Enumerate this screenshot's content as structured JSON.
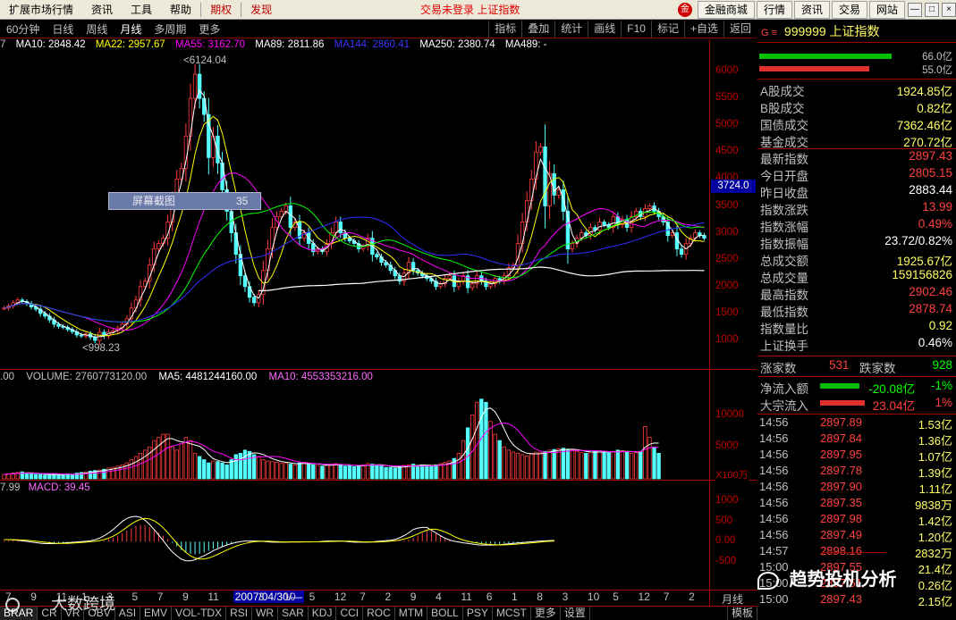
{
  "menu": {
    "items": [
      "扩展市场行情",
      "资讯",
      "工具",
      "帮助"
    ],
    "hl_items": [
      "期权",
      "发现"
    ],
    "center": "交易未登录  上证指数",
    "right_logo": "金",
    "right_buttons": [
      "金融商城",
      "行情",
      "资讯",
      "交易",
      "网站"
    ],
    "win": [
      "—",
      "□",
      "×"
    ]
  },
  "toolbar": {
    "items": [
      "60分钟",
      "日线",
      "周线",
      "月线",
      "多周期",
      "更多"
    ],
    "active_index": 3,
    "right": [
      "指标",
      "叠加",
      "统计",
      "画线",
      "F10",
      "标记",
      "+自选",
      "返回"
    ]
  },
  "ma_text": {
    "prefix": "7",
    "ma10": "MA10: 2848.42",
    "ma22": "MA22: 2957.67",
    "ma55": "MA55: 3162.70",
    "ma89": "MA89: 2811.86",
    "ma144": "MA144: 2860.41",
    "ma250": "MA250: 2380.74",
    "ma489": "MA489: -"
  },
  "colors": {
    "up": "#ff3c3c",
    "up_fill": "#000000",
    "down": "#54ffff",
    "ma10": "#ffffff",
    "ma22": "#ffff00",
    "ma55": "#ff00ff",
    "ma89": "#00ff00",
    "ma144": "#3030ff",
    "ma250": "#ffffff",
    "axis": "#c00000"
  },
  "main_axis": {
    "ticks": [
      "6000",
      "5500",
      "5000",
      "4500",
      "4000",
      "3500",
      "3000",
      "2500",
      "2000",
      "1500",
      "1000"
    ],
    "ylim": [
      700,
      6300
    ],
    "cursor_value": "3724.0"
  },
  "annotations": {
    "high": "6124.04",
    "low": "998.23"
  },
  "volume": {
    "label_prefix": ".00",
    "volume": "VOLUME: 2760773120.00",
    "ma5": "MA5: 4481244160.00",
    "ma10": "MA10: 4553353216.00",
    "ticks": [
      "10000",
      "5000"
    ],
    "unit": "X100万",
    "ylim": [
      0,
      14000
    ]
  },
  "macd": {
    "label_prefix": "7.99",
    "macd": "MACD: 39.45",
    "ticks": [
      "1000",
      "500",
      "0.00",
      "-500"
    ],
    "ylim": [
      -1100,
      1200
    ]
  },
  "xaxis": {
    "labels": [
      "7",
      "9",
      "11",
      "1",
      "3",
      "5",
      "7",
      "9",
      "11",
      "2007/04/30/—",
      "3",
      "10",
      "5",
      "12",
      "7",
      "2",
      "9",
      "4",
      "11",
      "6",
      "1",
      "8",
      "3",
      "10",
      "5",
      "12",
      "7",
      "2"
    ],
    "right_label": "月线"
  },
  "screenshot_tip": {
    "text": "屏幕截图",
    "num": "35"
  },
  "quote": {
    "code_prefix": "G ≡",
    "title": "999999 上证指数",
    "bar_vals": [
      "66.0亿",
      "55.0亿"
    ],
    "stats": [
      {
        "k": "A股成交",
        "v": "1924.85亿",
        "c": "#ffff66"
      },
      {
        "k": "B股成交",
        "v": "0.82亿",
        "c": "#ffff66"
      },
      {
        "k": "国债成交",
        "v": "7362.46亿",
        "c": "#ffff66"
      },
      {
        "k": "基金成交",
        "v": "270.72亿",
        "c": "#ffff66"
      },
      {
        "k": "最新指数",
        "v": "2897.43",
        "c": "#ff4040"
      },
      {
        "k": "今日开盘",
        "v": "2805.15",
        "c": "#ff4040"
      },
      {
        "k": "昨日收盘",
        "v": "2883.44",
        "c": "#ffffff"
      },
      {
        "k": "指数涨跌",
        "v": "13.99",
        "c": "#ff4040"
      },
      {
        "k": "指数涨幅",
        "v": "0.49%",
        "c": "#ff4040"
      },
      {
        "k": "指数振幅",
        "v": "23.72/0.82%",
        "c": "#ffffff"
      },
      {
        "k": "总成交额",
        "v": "1925.67亿",
        "c": "#ffff66"
      },
      {
        "k": "总成交量",
        "v": "159156826",
        "c": "#ffff66"
      },
      {
        "k": "最高指数",
        "v": "2902.46",
        "c": "#ff4040"
      },
      {
        "k": "最低指数",
        "v": "2878.74",
        "c": "#ff4040"
      },
      {
        "k": "指数量比",
        "v": "0.92",
        "c": "#ffff66"
      },
      {
        "k": "上证换手",
        "v": "0.46%",
        "c": "#ffffff"
      }
    ],
    "rise_label": "涨家数",
    "rise": "531",
    "fall_label": "跌家数",
    "fall": "928",
    "flow1_label": "净流入额",
    "flow1_val": "-20.08亿",
    "flow1_pct": "-1%",
    "flow2_label": "大宗流入",
    "flow2_val": "23.04亿",
    "flow2_pct": "1%",
    "ticks": [
      {
        "t": "14:56",
        "p": "2897.89",
        "q": "1.53亿"
      },
      {
        "t": "14:56",
        "p": "2897.84",
        "q": "1.36亿"
      },
      {
        "t": "14:56",
        "p": "2897.95",
        "q": "1.07亿"
      },
      {
        "t": "14:56",
        "p": "2897.78",
        "q": "1.39亿"
      },
      {
        "t": "14:56",
        "p": "2897.90",
        "q": "1.11亿"
      },
      {
        "t": "14:56",
        "p": "2897.35",
        "q": "9838万"
      },
      {
        "t": "14:56",
        "p": "2897.98",
        "q": "1.42亿"
      },
      {
        "t": "14:56",
        "p": "2897.49",
        "q": "1.20亿"
      },
      {
        "t": "14:57",
        "p": "2898.16",
        "q": "2832万"
      },
      {
        "t": "15:00",
        "p": "2897.55",
        "q": "21.4亿"
      },
      {
        "t": "15:00",
        "p": "2897.51",
        "q": "0.26亿"
      },
      {
        "t": "15:00",
        "p": "2897.43",
        "q": "2.15亿"
      }
    ]
  },
  "tabs": [
    "BRAR",
    "CR",
    "VR",
    "OBV",
    "ASI",
    "EMV",
    "VOL-TDX",
    "RSI",
    "WR",
    "SAR",
    "KDJ",
    "CCI",
    "ROC",
    "MTM",
    "BOLL",
    "PSY",
    "MCST",
    "更多",
    "设置"
  ],
  "tabs_right": "模板",
  "watermarks": {
    "left": "大数跨境",
    "right": "趋势投机分析"
  },
  "chart_data": {
    "type": "candlestick",
    "closes": [
      1600,
      1640,
      1700,
      1750,
      1720,
      1680,
      1620,
      1580,
      1500,
      1450,
      1380,
      1300,
      1260,
      1240,
      1200,
      1160,
      1100,
      1080,
      1120,
      1060,
      998,
      1150,
      1080,
      1160,
      1180,
      1230,
      1300,
      1400,
      1600,
      1750,
      2000,
      2100,
      2400,
      2700,
      2800,
      2900,
      3200,
      3600,
      4000,
      4200,
      4800,
      5500,
      5950,
      5500,
      5200,
      4400,
      4800,
      4300,
      3800,
      3400,
      3000,
      2600,
      2200,
      2000,
      1800,
      1700,
      1850,
      2300,
      2700,
      3100,
      3300,
      3400,
      3500,
      3100,
      3200,
      2900,
      3000,
      2800,
      2650,
      2700,
      2650,
      2800,
      3000,
      3200,
      3000,
      2900,
      2850,
      2800,
      2700,
      2750,
      2900,
      2600,
      2550,
      2450,
      2400,
      2300,
      2200,
      2100,
      2250,
      2450,
      2300,
      2250,
      2200,
      2150,
      2100,
      2000,
      2050,
      2150,
      2200,
      2000,
      2100,
      2200,
      1980,
      2050,
      2200,
      2100,
      2000,
      2050,
      2150,
      2100,
      2200,
      2350,
      2400,
      2800,
      3200,
      3600,
      4000,
      4500,
      4600,
      3500,
      4100,
      3700,
      3800,
      3400,
      2700,
      2800,
      2900,
      3000,
      2950,
      3100,
      3050,
      3200,
      3150,
      3100,
      3300,
      3150,
      3250,
      3100,
      3300,
      3400,
      3300,
      3450,
      3500,
      3400,
      3300,
      3200,
      2950,
      3000,
      2700,
      2600,
      2800,
      2900,
      3000,
      2950,
      2900
    ],
    "volume": [
      700,
      800,
      900,
      1000,
      1100,
      900,
      800,
      700,
      700,
      600,
      700,
      800,
      700,
      600,
      800,
      700,
      900,
      1000,
      1100,
      1200,
      1300,
      1400,
      1500,
      1700,
      1800,
      2000,
      2200,
      2500,
      3000,
      3500,
      4000,
      4500,
      5000,
      6000,
      6500,
      7000,
      7000,
      5000,
      4500,
      5500,
      6500,
      6000,
      4000,
      3500,
      3000,
      2500,
      2800,
      2700,
      2500,
      2200,
      3000,
      3800,
      4000,
      4500,
      4300,
      3800,
      3500,
      3000,
      2800,
      2700,
      2600,
      2400,
      2500,
      2300,
      2200,
      2500,
      2600,
      2400,
      2200,
      2100,
      2000,
      2100,
      2300,
      2400,
      2200,
      2000,
      2100,
      1900,
      2000,
      2200,
      2400,
      2300,
      2100,
      2000,
      1800,
      1800,
      1700,
      1900,
      2100,
      2200,
      2300,
      2000,
      2200,
      2100,
      2000,
      2200,
      2400,
      2600,
      2800,
      3200,
      4000,
      6000,
      8000,
      10000,
      12000,
      12500,
      12000,
      9000,
      7000,
      6000,
      5000,
      4500,
      4200,
      4000,
      3800,
      3600,
      4000,
      4200,
      4100,
      4300,
      4500,
      4600,
      4700,
      4800,
      4600,
      4500,
      4300,
      4100,
      4000,
      4200,
      4300,
      4400,
      4200,
      4100,
      4300,
      4500,
      4400,
      4200,
      4000,
      4100,
      4300,
      8200,
      6500,
      5000,
      4000
    ],
    "macd": [
      50,
      60,
      60,
      50,
      40,
      30,
      20,
      0,
      -20,
      -40,
      -50,
      -60,
      -60,
      -50,
      -40,
      -30,
      -20,
      -10,
      -5,
      0,
      10,
      20,
      40,
      80,
      150,
      250,
      350,
      450,
      550,
      650,
      700,
      680,
      600,
      500,
      380,
      250,
      100,
      -50,
      -200,
      -350,
      -450,
      -500,
      -520,
      -500,
      -450,
      -380,
      -300,
      -250,
      -200,
      -150,
      -100,
      -50,
      -20,
      0,
      10,
      20,
      30,
      20,
      10,
      0,
      -10,
      -20,
      -30,
      -20,
      -10,
      0,
      10,
      0,
      -10,
      -20,
      -10,
      0,
      10,
      20,
      30,
      20,
      10,
      0,
      -10,
      -20,
      -30,
      -20,
      -10,
      0,
      10,
      20,
      30,
      40,
      50,
      80,
      150,
      250,
      350,
      450,
      420,
      350,
      250,
      150,
      80,
      40,
      20,
      0,
      -20,
      -40,
      -60,
      -70,
      -80,
      -90,
      -100,
      -90,
      -80,
      -70,
      -60,
      -50,
      -40,
      -30,
      -20,
      -10,
      0,
      10,
      20,
      30
    ]
  }
}
